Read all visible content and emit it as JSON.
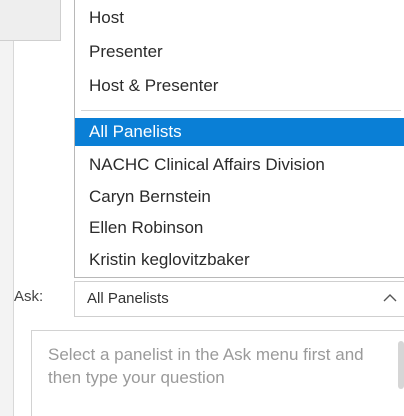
{
  "dropdown": {
    "options": [
      {
        "label": "Host"
      },
      {
        "label": "Presenter"
      },
      {
        "label": "Host & Presenter"
      },
      {
        "label": "All Panelists",
        "selected": true
      },
      {
        "label": "NACHC Clinical Affairs Division"
      },
      {
        "label": "Caryn Bernstein"
      },
      {
        "label": "Ellen Robinson"
      },
      {
        "label": "Kristin keglovitzbaker"
      }
    ]
  },
  "ask": {
    "label": "Ask:",
    "selected_value": "All Panelists"
  },
  "question": {
    "placeholder": "Select a panelist in the Ask menu first and then type your question"
  },
  "colors": {
    "selection": "#0a7fd6",
    "placeholder_text": "#9a9a9a"
  },
  "icons": {
    "ask_toggle": "chevron-up-icon"
  }
}
